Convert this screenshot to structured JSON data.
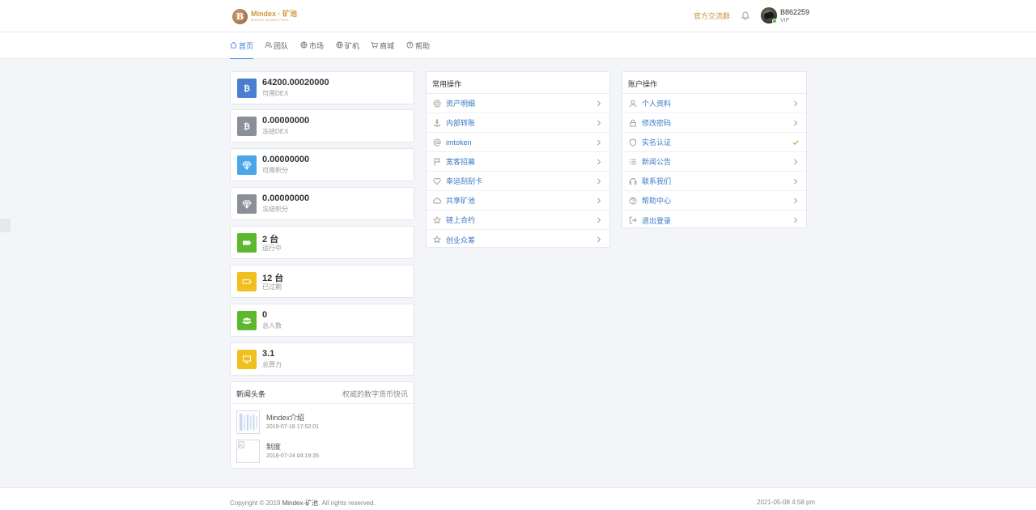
{
  "brand": {
    "name": "Mindex · 矿池",
    "tagline": "MINDEX MINING POOL",
    "mark": "B"
  },
  "header": {
    "community_link": "官方交流群",
    "user_id": "B862259",
    "user_level": "VIP"
  },
  "nav": [
    {
      "label": "首页",
      "icon": "home-icon"
    },
    {
      "label": "团队",
      "icon": "users-icon"
    },
    {
      "label": "市场",
      "icon": "globe-icon"
    },
    {
      "label": "矿机",
      "icon": "globe-icon"
    },
    {
      "label": "商城",
      "icon": "cart-icon"
    },
    {
      "label": "帮助",
      "icon": "help-icon"
    }
  ],
  "stats": [
    {
      "value": "64200.00020000",
      "label": "可用DEX",
      "color": "#4a7fd0",
      "icon": "bitcoin-icon"
    },
    {
      "value": "0.00000000",
      "label": "冻结DEX",
      "color": "#8a8f98",
      "icon": "bitcoin-icon"
    },
    {
      "value": "0.00000000",
      "label": "可用积分",
      "color": "#4aa6e8",
      "icon": "diamond-icon"
    },
    {
      "value": "0.00000000",
      "label": "冻结积分",
      "color": "#8a8f98",
      "icon": "diamond-icon"
    },
    {
      "value": "2 台",
      "label": "运行中",
      "color": "#5cb82e",
      "icon": "battery-full-icon"
    },
    {
      "value": "12 台",
      "label": "已过期",
      "color": "#f0c020",
      "icon": "battery-empty-icon"
    },
    {
      "value": "0",
      "label": "总人数",
      "color": "#5cb82e",
      "icon": "group-icon"
    },
    {
      "value": "3.1",
      "label": "总算力",
      "color": "#f0c020",
      "icon": "monitor-icon"
    }
  ],
  "news": {
    "title": "新闻头条",
    "subtitle": "权威的数字货币快讯",
    "items": [
      {
        "title": "Mindex介绍",
        "date": "2019-07-18 17:52:01"
      },
      {
        "title": "制度",
        "date": "2018-07-24 04:19:35"
      }
    ]
  },
  "common_ops": {
    "title": "常用操作",
    "items": [
      {
        "label": "资产明细",
        "icon": "coin-icon"
      },
      {
        "label": "内部转账",
        "icon": "anchor-icon"
      },
      {
        "label": "imtoken",
        "icon": "at-icon"
      },
      {
        "label": "宽客招募",
        "icon": "flag-icon"
      },
      {
        "label": "幸运刮刮卡",
        "icon": "heart-icon"
      },
      {
        "label": "共享矿池",
        "icon": "cloud-icon"
      },
      {
        "label": "链上合约",
        "icon": "star-icon"
      },
      {
        "label": "创业众筹",
        "icon": "star-icon"
      }
    ]
  },
  "account_ops": {
    "title": "账户操作",
    "items": [
      {
        "label": "个人资料",
        "icon": "user-icon",
        "trail": "chevron"
      },
      {
        "label": "修改密码",
        "icon": "lock-icon",
        "trail": "chevron"
      },
      {
        "label": "实名认证",
        "icon": "shield-icon",
        "trail": "check"
      },
      {
        "label": "新闻公告",
        "icon": "list-icon",
        "trail": "chevron"
      },
      {
        "label": "联系我们",
        "icon": "headset-icon",
        "trail": "chevron"
      },
      {
        "label": "帮助中心",
        "icon": "help-icon",
        "trail": "chevron"
      },
      {
        "label": "退出登录",
        "icon": "logout-icon",
        "trail": "chevron"
      }
    ]
  },
  "footer": {
    "copyright_prefix": "Copyright © 2019 ",
    "copyright_brand": "Mindex-矿池",
    "copyright_suffix": ". All rights reserved.",
    "datetime": "2021-05-08 4:58 pm"
  },
  "colors": {
    "accent": "#3b7ddd",
    "gold": "#c7953f",
    "check": "#5cb82e"
  }
}
